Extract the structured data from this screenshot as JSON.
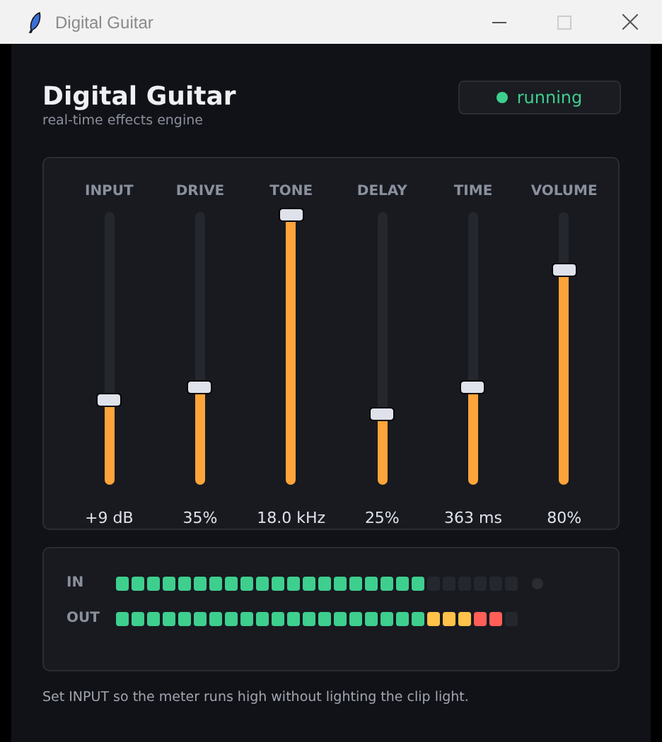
{
  "window": {
    "title": "Digital Guitar"
  },
  "header": {
    "title": "Digital Guitar",
    "subtitle": "real-time effects engine",
    "status": {
      "label": "running",
      "on": true
    }
  },
  "sliders": [
    {
      "label": "INPUT",
      "level": 0.31,
      "reading": "+9 dB"
    },
    {
      "label": "DRIVE",
      "level": 0.36,
      "reading": "35%"
    },
    {
      "label": "TONE",
      "level": 0.99,
      "reading": "18.0 kHz"
    },
    {
      "label": "DELAY",
      "level": 0.26,
      "reading": "25%"
    },
    {
      "label": "TIME",
      "level": 0.36,
      "reading": "363 ms"
    },
    {
      "label": "VOLUME",
      "level": 0.79,
      "reading": "80%"
    }
  ],
  "meters": [
    {
      "label": "IN",
      "level": 0.769,
      "clip": {
        "on": false
      }
    },
    {
      "label": "OUT",
      "level": 0.962
    }
  ],
  "hint": "Set INPUT so the meter runs high without lighting the clip light."
}
